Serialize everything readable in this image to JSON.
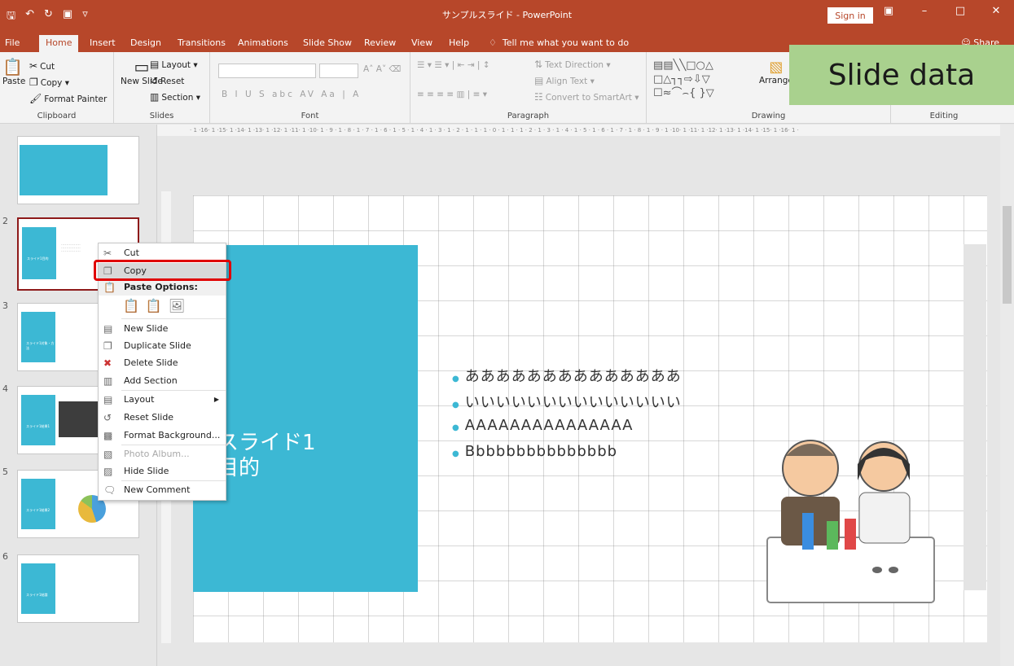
{
  "window": {
    "title": "サンプルスライド  -  PowerPoint",
    "sign_in": "Sign in",
    "share": "Share"
  },
  "tabs": [
    "File",
    "Home",
    "Insert",
    "Design",
    "Transitions",
    "Animations",
    "Slide Show",
    "Review",
    "View",
    "Help",
    "Tell me what you want to do"
  ],
  "ribbon": {
    "clipboard": {
      "label": "Clipboard",
      "paste": "Paste",
      "cut": "Cut",
      "copy": "Copy",
      "format_painter": "Format Painter"
    },
    "slides": {
      "label": "Slides",
      "new_slide": "New Slide",
      "layout": "Layout",
      "reset": "Reset",
      "section": "Section"
    },
    "font": {
      "label": "Font"
    },
    "paragraph": {
      "label": "Paragraph",
      "text_direction": "Text Direction",
      "align_text": "Align Text",
      "convert_smartart": "Convert to SmartArt"
    },
    "drawing": {
      "label": "Drawing",
      "arrange": "Arrange"
    },
    "editing": {
      "label": "Editing"
    }
  },
  "overlay_label": "Slide data",
  "thumbnails": [
    {
      "num": "",
      "mini": ""
    },
    {
      "num": "2",
      "mini": "スライド1目的"
    },
    {
      "num": "3",
      "mini": "スライド1対象・方法"
    },
    {
      "num": "4",
      "mini": "スライド1結果1"
    },
    {
      "num": "5",
      "mini": "スライド1結果2"
    },
    {
      "num": "6",
      "mini": "スライド1結論"
    }
  ],
  "ruler": "· 1 ·16· 1 ·15· 1 ·14· 1 ·13· 1 ·12· 1 ·11· 1 ·10· 1 · 9 · 1 · 8 · 1 · 7 · 1 · 6 · 1 · 5 · 1 · 4 · 1 · 3 · 1 · 2 · 1 · 1 · 1 · 0 · 1 · 1 · 1 · 2 · 1 · 3 · 1 · 4 · 1 · 5 · 1 · 6 · 1 · 7 · 1 · 8 · 1 · 9 · 1 ·10· 1 ·11· 1 ·12· 1 ·13· 1 ·14· 1 ·15· 1 ·16· 1 ·",
  "slide": {
    "title_line1": "スライド1",
    "title_line2": "目的",
    "bullets": [
      "ああああああああああああああ",
      "いいいいいいいいいいいいいい",
      "AAAAAAAAAAAAAAA",
      "Bbbbbbbbbbbbbbb"
    ]
  },
  "context_menu": {
    "cut": "Cut",
    "copy": "Copy",
    "paste_options": "Paste Options:",
    "new_slide": "New Slide",
    "duplicate_slide": "Duplicate Slide",
    "delete_slide": "Delete Slide",
    "add_section": "Add Section",
    "layout": "Layout",
    "reset_slide": "Reset Slide",
    "format_background": "Format Background...",
    "photo_album": "Photo Album...",
    "hide_slide": "Hide Slide",
    "new_comment": "New Comment"
  },
  "colors": {
    "accent": "#b7472a",
    "slide_blue": "#3cb8d4",
    "highlight": "#e00000",
    "overlay": "#a9d18e"
  }
}
